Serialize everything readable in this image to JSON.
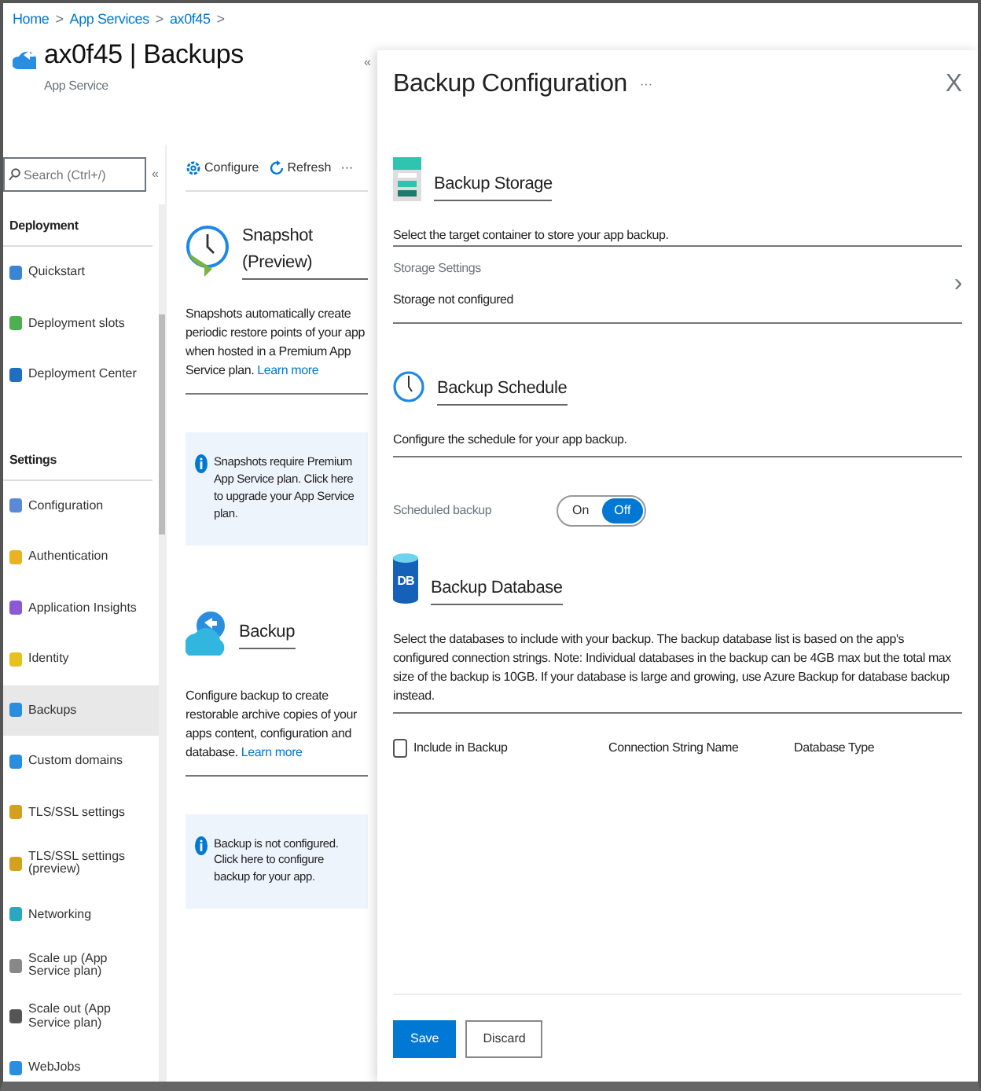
{
  "breadcrumb": [
    {
      "kind": "link",
      "label": "Home"
    },
    {
      "kind": "separator",
      "label": ">"
    },
    {
      "kind": "link",
      "label": "App Services"
    },
    {
      "kind": "separator",
      "label": ">"
    },
    {
      "kind": "link",
      "label": "ax0f45"
    },
    {
      "kind": "separator",
      "label": ">"
    }
  ],
  "resource": {
    "title": "ax0f45 | Backups",
    "subtitle": "App Service",
    "collapse": "«"
  },
  "search": {
    "placeholder": "Search (Ctrl+/)",
    "collapse": "«"
  },
  "sidebar": {
    "sections": [
      {
        "title": "Deployment",
        "items": [
          {
            "label": "Quickstart",
            "selected": false
          },
          {
            "label": "Deployment slots",
            "selected": false
          },
          {
            "label": "Deployment Center",
            "selected": false
          }
        ]
      },
      {
        "title": "Settings",
        "items": [
          {
            "label": "Configuration",
            "selected": false
          },
          {
            "label": "Authentication",
            "selected": false
          },
          {
            "label": "Application Insights",
            "selected": false
          },
          {
            "label": "Identity",
            "selected": false
          },
          {
            "label": "Backups",
            "selected": true
          },
          {
            "label": "Custom domains",
            "selected": false
          },
          {
            "label": "TLS/SSL settings",
            "selected": false
          },
          {
            "label": "TLS/SSL settings (preview)",
            "selected": false
          },
          {
            "label": "Networking",
            "selected": false
          },
          {
            "label": "Scale up (App Service plan)",
            "selected": false
          },
          {
            "label": "Scale out (App Service plan)",
            "selected": false
          },
          {
            "label": "WebJobs",
            "selected": false
          }
        ]
      }
    ]
  },
  "toolbar": [
    {
      "kind": "configure",
      "label": "Configure"
    },
    {
      "kind": "refresh",
      "label": "Refresh"
    },
    {
      "kind": "more",
      "label": "···"
    }
  ],
  "cards": [
    {
      "kind": "snapshot",
      "title": "Snapshot (Preview)",
      "description": "Snapshots automatically create periodic restore points of your app when hosted in a Premium App Service plan.",
      "link": "Learn more",
      "info": "Snapshots require Premium App Service plan. Click here to upgrade your App Service plan."
    },
    {
      "kind": "backup",
      "title": "Backup",
      "description": "Configure backup to create restorable archive copies of your apps content, configuration and database.",
      "link": "Learn more",
      "info": "Backup is not configured. Click here to configure backup for your app."
    }
  ],
  "panel": {
    "title": "Backup Configuration",
    "more": "···",
    "close": "X",
    "storage": {
      "title": "Backup Storage",
      "description": "Select the target container to store your app backup.",
      "field_label": "Storage Settings",
      "field_value": "Storage not configured",
      "chevron": "›"
    },
    "schedule": {
      "title": "Backup Schedule",
      "description": "Configure the schedule for your app backup.",
      "label": "Scheduled backup",
      "options": [
        {
          "label": "On",
          "selected": false
        },
        {
          "label": "Off",
          "selected": true
        }
      ]
    },
    "database": {
      "title": "Backup Database",
      "icon_text": "DB",
      "description": "Select the databases to include with your backup. The backup database list is based on the app's configured connection strings. Note: Individual databases in the backup can be 4GB max but the total max size of the backup is 10GB. If your database is large and growing, use Azure Backup for database backup instead.",
      "select_all": {
        "checked": false
      },
      "columns": [
        "Include in Backup",
        "Connection String Name",
        "Database Type"
      ]
    },
    "buttons": [
      {
        "kind": "primary",
        "label": "Save"
      },
      {
        "kind": "secondary",
        "label": "Discard"
      }
    ]
  }
}
